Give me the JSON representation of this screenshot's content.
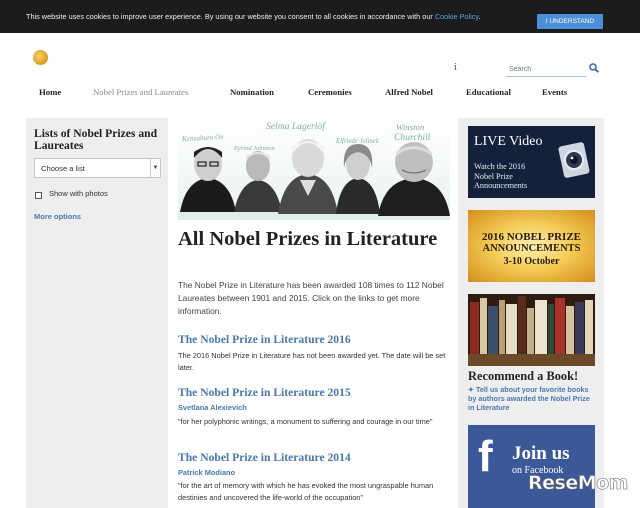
{
  "cookie": {
    "text": "This website uses cookies to improve user experience. By using our website you consent to all cookies in accordance with our ",
    "link": "Cookie Policy",
    "period": ".",
    "button": "I UNDERSTAND"
  },
  "header": {
    "info_glyph": "i",
    "search_placeholder": "Search"
  },
  "nav": [
    {
      "label": "Home"
    },
    {
      "label": "Nobel Prizes and Laureates"
    },
    {
      "label": "Nomination"
    },
    {
      "label": "Ceremonies"
    },
    {
      "label": "Alfred Nobel"
    },
    {
      "label": "Educational"
    },
    {
      "label": "Events"
    }
  ],
  "sidebar": {
    "title": "Lists of Nobel Prizes and Laureates",
    "select_value": "Choose a list",
    "checkbox_label": "Show with photos",
    "more_options": "More options"
  },
  "hero": {
    "names": [
      "Kenzaburo Oe",
      "Eyvind Johnson",
      "Selma Lagerlöf",
      "Elfriede Jelinek",
      "Winston",
      "Churchill"
    ]
  },
  "main": {
    "title": "All Nobel Prizes in Literature",
    "intro": "The Nobel Prize in Literature has been awarded 108 times to 112 Nobel Laureates between 1901 and 2015. Click on the links to get more information.",
    "prizes": [
      {
        "title": "The Nobel Prize in Literature 2016",
        "laureate": "",
        "text": "The 2016 Nobel Prize in Literature has not been awarded yet. The date will be set later."
      },
      {
        "title": "The Nobel Prize in Literature 2015",
        "laureate": "Svetlana Alexievich",
        "text": "\"for her polyphonic writings, a monument to suffering and courage in our time\""
      },
      {
        "title": "The Nobel Prize in Literature 2014",
        "laureate": "Patrick Modiano",
        "text": "\"for the art of memory with which he has evoked the most ungraspable human destinies and uncovered the life-world of the occupation\""
      }
    ]
  },
  "right": {
    "live_title": "LIVE Video",
    "live_sub": [
      "Watch the 2016",
      "Nobel Prize",
      "Announcements"
    ],
    "announce": [
      "2016 NOBEL PRIZE",
      "ANNOUNCEMENTS",
      "3-10 October"
    ],
    "recommend_title": "Recommend a Book!",
    "recommend_text": "✦ Tell us about your favorite books by authors awarded the Nobel Prize in Literature",
    "fb_letter": "f",
    "fb_join": "Join us",
    "fb_on": "on Facebook"
  },
  "watermark": "ReseMom",
  "colors": {
    "cookie_bar": "#1c1c1c",
    "cookie_button": "#4d8fd6",
    "link_blue": "#4a78ad",
    "panel_gray": "#eeeeee",
    "facebook": "#3b5998"
  }
}
